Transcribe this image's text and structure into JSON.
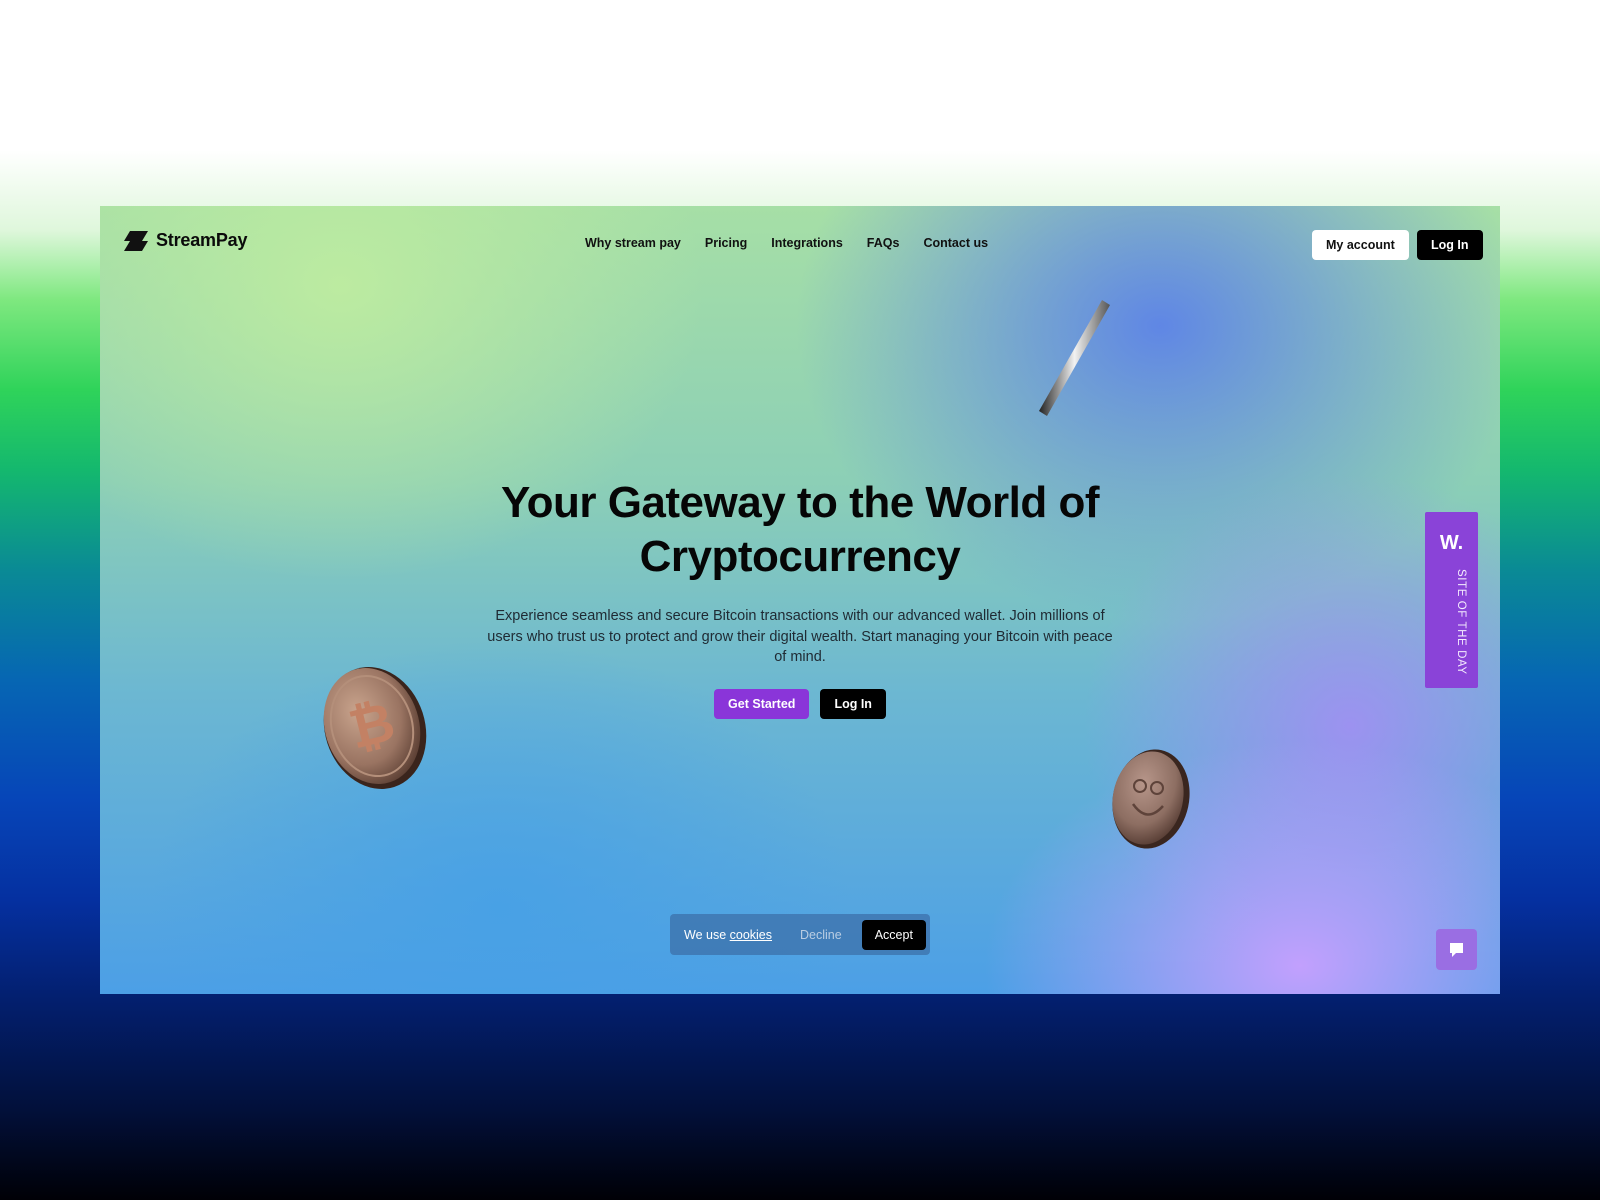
{
  "brand": {
    "name": "StreamPay",
    "logo_icon": "streampay-logo-icon"
  },
  "nav": {
    "links": [
      "Why stream pay",
      "Pricing",
      "Integrations",
      "FAQs",
      "Contact us"
    ],
    "account_label": "My account",
    "login_label": "Log In"
  },
  "hero": {
    "title_line1": "Your Gateway to the World of",
    "title_line2": "Cryptocurrency",
    "subtitle": "Experience seamless and secure Bitcoin transactions with our advanced wallet. Join millions of users who trust us to protect and grow their digital wealth. Start managing your Bitcoin with peace of mind.",
    "cta_primary": "Get Started",
    "cta_secondary": "Log In"
  },
  "badge": {
    "logo": "W.",
    "text": "SITE OF THE DAY"
  },
  "cookie": {
    "prefix": "We use ",
    "link": "cookies",
    "decline": "Decline",
    "accept": "Accept"
  },
  "colors": {
    "accent_purple": "#8a35d9",
    "badge_purple": "#8a43d8",
    "dark": "#000000"
  },
  "icons": [
    "streampay-logo-icon",
    "bitcoin-coin-icon",
    "smiley-coin-icon",
    "coin-edge-icon",
    "chat-icon"
  ]
}
